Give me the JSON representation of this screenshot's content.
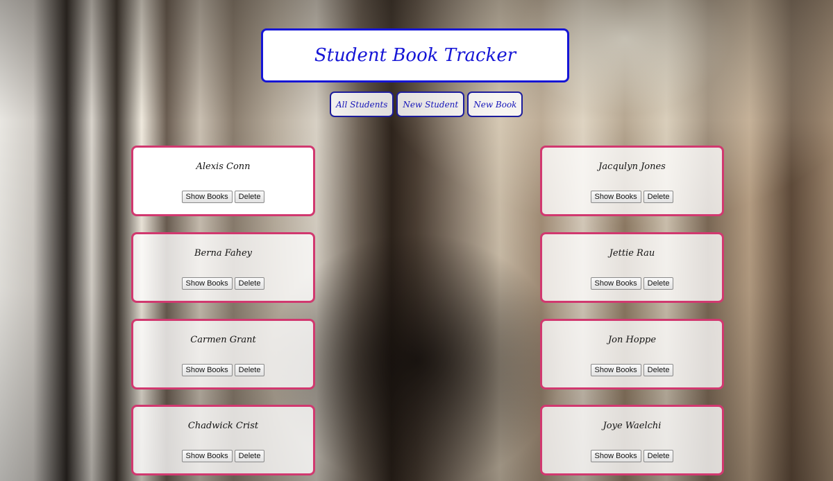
{
  "app": {
    "title": "Student Book Tracker"
  },
  "nav": {
    "all_students": "All Students",
    "new_student": "New Student",
    "new_book": "New Book"
  },
  "students": [
    {
      "name": "Alexis Conn",
      "show_books": "Show Books",
      "delete": "Delete"
    },
    {
      "name": "Jacqulyn Jones",
      "show_books": "Show Books",
      "delete": "Delete"
    },
    {
      "name": "Berna Fahey",
      "show_books": "Show Books",
      "delete": "Delete"
    },
    {
      "name": "Jettie Rau",
      "show_books": "Show Books",
      "delete": "Delete"
    },
    {
      "name": "Carmen Grant",
      "show_books": "Show Books",
      "delete": "Delete"
    },
    {
      "name": "Jon Hoppe",
      "show_books": "Show Books",
      "delete": "Delete"
    },
    {
      "name": "Chadwick Crist",
      "show_books": "Show Books",
      "delete": "Delete"
    },
    {
      "name": "Joye Waelchi",
      "show_books": "Show Books",
      "delete": "Delete"
    }
  ],
  "colors": {
    "header_accent": "#1515d6",
    "card_border": "#d1386f"
  }
}
